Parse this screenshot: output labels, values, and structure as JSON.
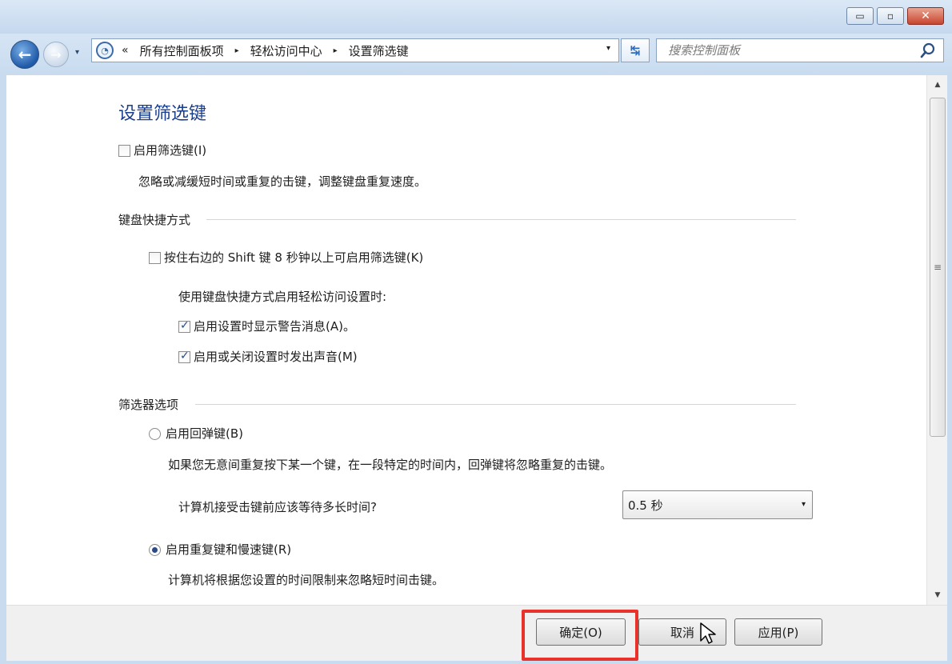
{
  "window": {
    "controls": {
      "minimize": "▭",
      "maximize": "▫",
      "close": "✕"
    }
  },
  "nav": {
    "back_icon": "←",
    "forward_icon": "→",
    "dropdown_icon": "▾",
    "address_chevron": "«",
    "breadcrumbs": [
      "所有控制面板项",
      "轻松访问中心",
      "设置筛选键"
    ],
    "separator": "▸",
    "refresh_icon": "↹",
    "search_placeholder": "搜索控制面板"
  },
  "main": {
    "title": "设置筛选键",
    "enable_filter_keys": {
      "label": "启用筛选键(I)",
      "checked": false
    },
    "description": "忽略或减缓短时间或重复的击键，调整键盘重复速度。",
    "shortcut_group": {
      "label": "键盘快捷方式",
      "shift_option": {
        "label": "按住右边的 Shift 键 8 秒钟以上可启用筛选键(K)",
        "checked": false
      },
      "when_label": "使用键盘快捷方式启用轻松访问设置时:",
      "warning_option": {
        "label": "启用设置时显示警告消息(A)。",
        "checked": true
      },
      "sound_option": {
        "label": "启用或关闭设置时发出声音(M)",
        "checked": true
      }
    },
    "filter_group": {
      "label": "筛选器选项",
      "bounce_keys": {
        "label": "启用回弹键(B)",
        "selected": false
      },
      "bounce_desc": "如果您无意间重复按下某一个键，在一段特定的时间内，回弹键将忽略重复的击键。",
      "wait_question": "计算机接受击键前应该等待多长时间?",
      "wait_value": "0.5 秒",
      "repeat_keys": {
        "label": "启用重复键和慢速键(R)",
        "selected": true
      },
      "repeat_desc": "计算机将根据您设置的时间限制来忽略短时间击键。"
    }
  },
  "footer": {
    "ok_label": "确定(O)",
    "cancel_label": "取消",
    "apply_label": "应用(P)"
  },
  "colors": {
    "title": "#1a3e8c",
    "highlight": "#e8322a",
    "frame": "#c9dbef"
  }
}
